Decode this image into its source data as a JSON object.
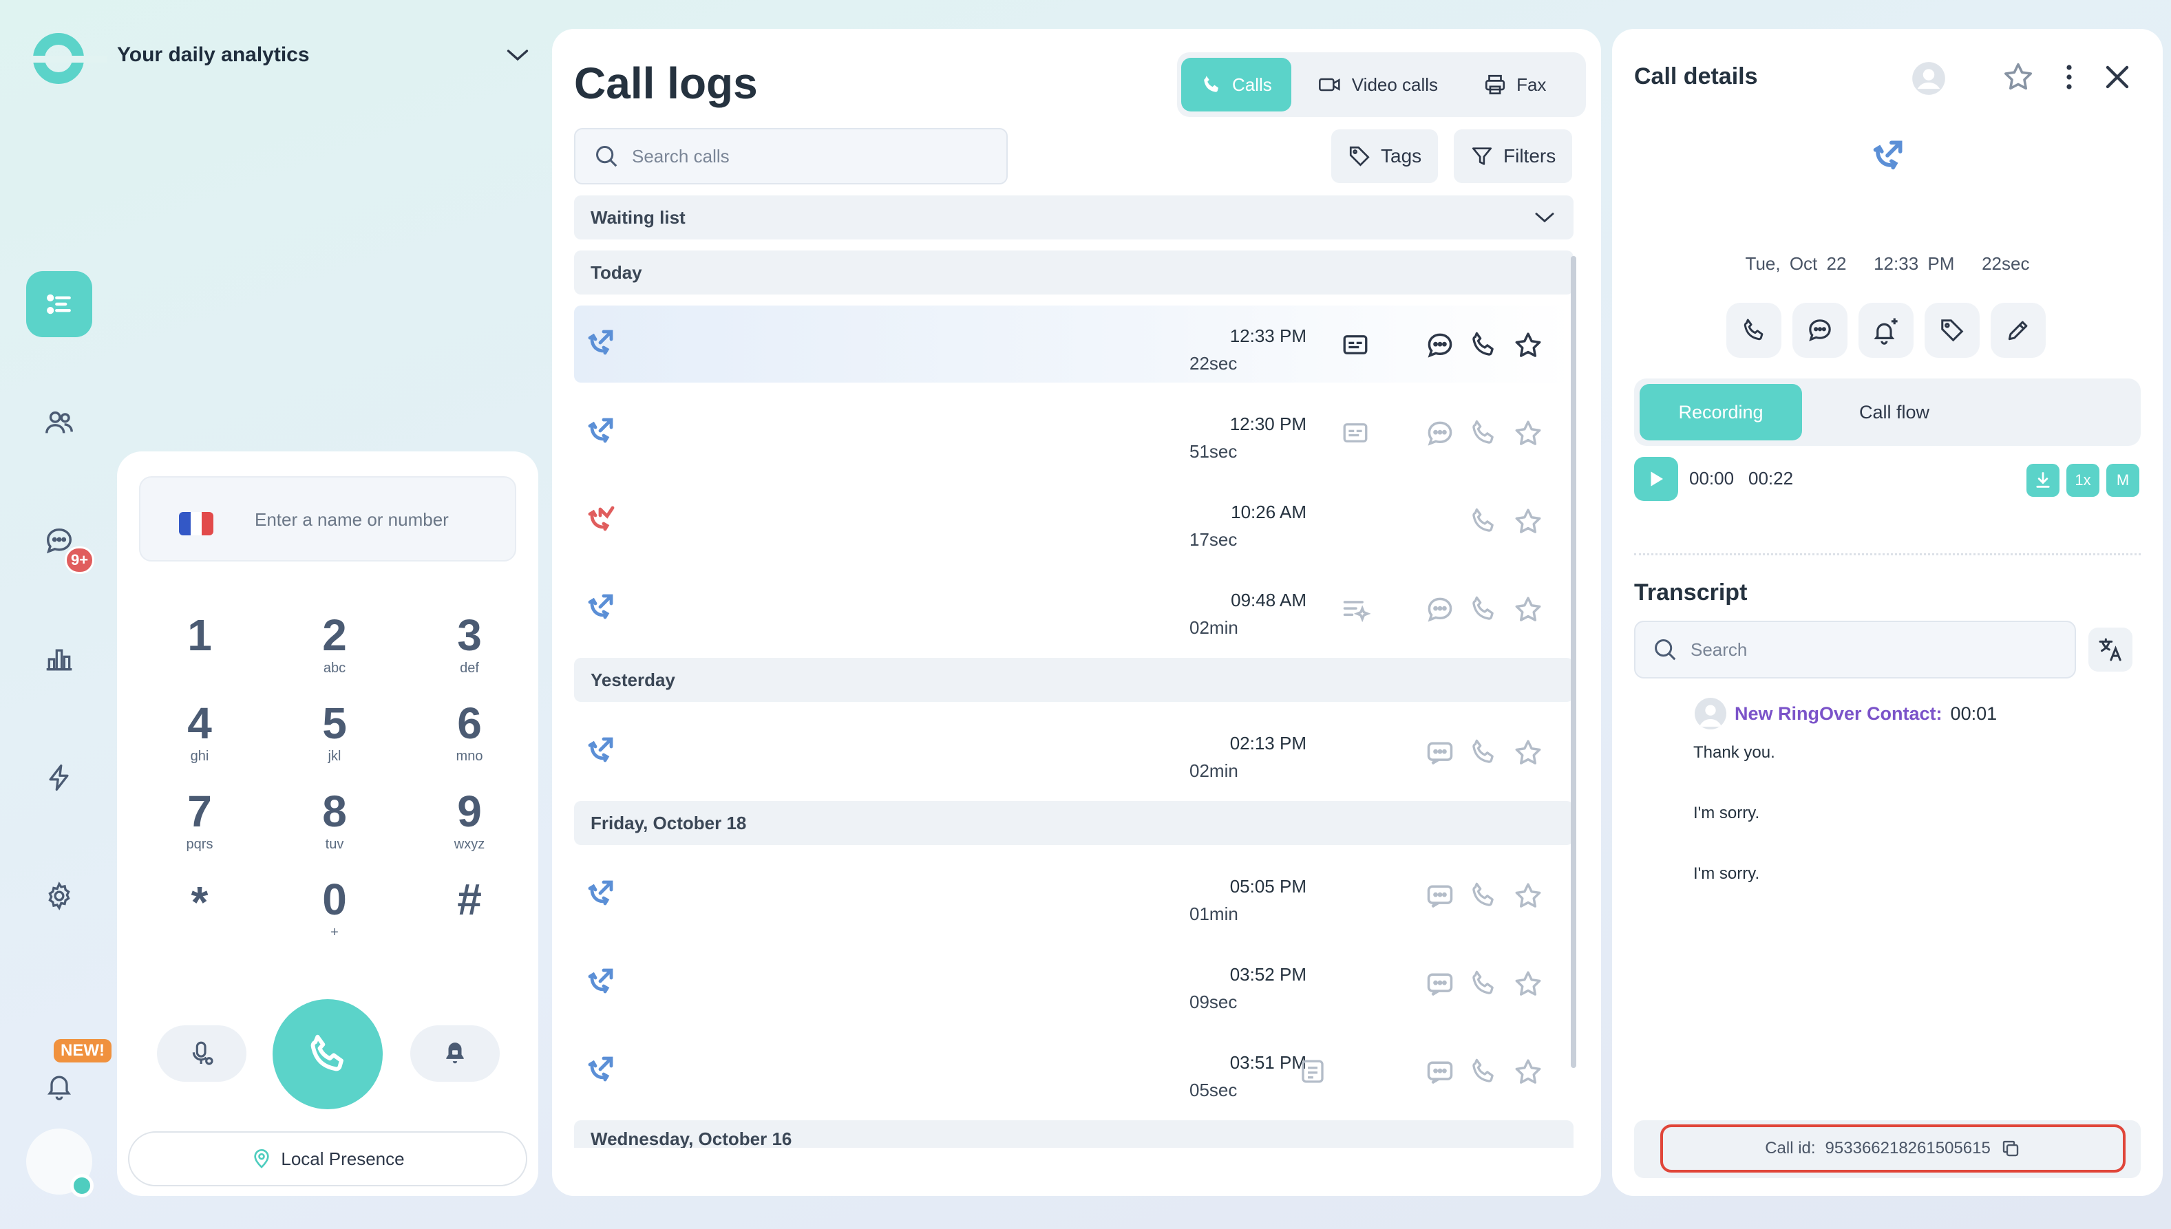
{
  "header": {
    "title": "Your daily analytics"
  },
  "rail": {
    "messages_badge": "9+",
    "new_badge": "NEW!"
  },
  "dialer": {
    "placeholder": "Enter a name or number",
    "keys": [
      {
        "d": "1",
        "l": ""
      },
      {
        "d": "2",
        "l": "abc"
      },
      {
        "d": "3",
        "l": "def"
      },
      {
        "d": "4",
        "l": "ghi"
      },
      {
        "d": "5",
        "l": "jkl"
      },
      {
        "d": "6",
        "l": "mno"
      },
      {
        "d": "7",
        "l": "pqrs"
      },
      {
        "d": "8",
        "l": "tuv"
      },
      {
        "d": "9",
        "l": "wxyz"
      },
      {
        "d": "*",
        "l": ""
      },
      {
        "d": "0",
        "l": "+"
      },
      {
        "d": "#",
        "l": ""
      }
    ],
    "local_presence": "Local Presence"
  },
  "logs": {
    "title": "Call logs",
    "tabs": {
      "calls": "Calls",
      "video": "Video calls",
      "fax": "Fax"
    },
    "search_placeholder": "Search calls",
    "tags": "Tags",
    "filters": "Filters",
    "waiting_list": "Waiting list",
    "sections": {
      "today": "Today",
      "yesterday": "Yesterday",
      "friday": "Friday, October 18",
      "wednesday": "Wednesday, October 16"
    },
    "rows": [
      {
        "time": "12:33 PM",
        "dur": "22sec"
      },
      {
        "time": "12:30 PM",
        "dur": "51sec"
      },
      {
        "time": "10:26 AM",
        "dur": "17sec"
      },
      {
        "time": "09:48 AM",
        "dur": "02min"
      },
      {
        "time": "02:13 PM",
        "dur": "02min"
      },
      {
        "time": "05:05 PM",
        "dur": "01min"
      },
      {
        "time": "03:52 PM",
        "dur": "09sec"
      },
      {
        "time": "03:51 PM",
        "dur": "05sec"
      }
    ]
  },
  "details": {
    "title": "Call details",
    "date": "Tue, Oct 22",
    "time": "12:33 PM",
    "duration": "22sec",
    "tabs": {
      "recording": "Recording",
      "flow": "Call flow"
    },
    "player": {
      "current": "00:00",
      "total": "00:22",
      "speed": "1x",
      "mono": "M"
    },
    "transcript_title": "Transcript",
    "search_placeholder": "Search",
    "speaker": "New RingOver Contact:",
    "speaker_time": "00:01",
    "lines": [
      "Thank you.",
      "I'm sorry.",
      "I'm sorry."
    ],
    "call_id_label": "Call id:",
    "call_id": "953366218261505615"
  },
  "colors": {
    "accent": "#5bd3c9",
    "missed": "#e05d5d",
    "outgoing": "#5b8fd6",
    "highlight": "#e0463a"
  }
}
